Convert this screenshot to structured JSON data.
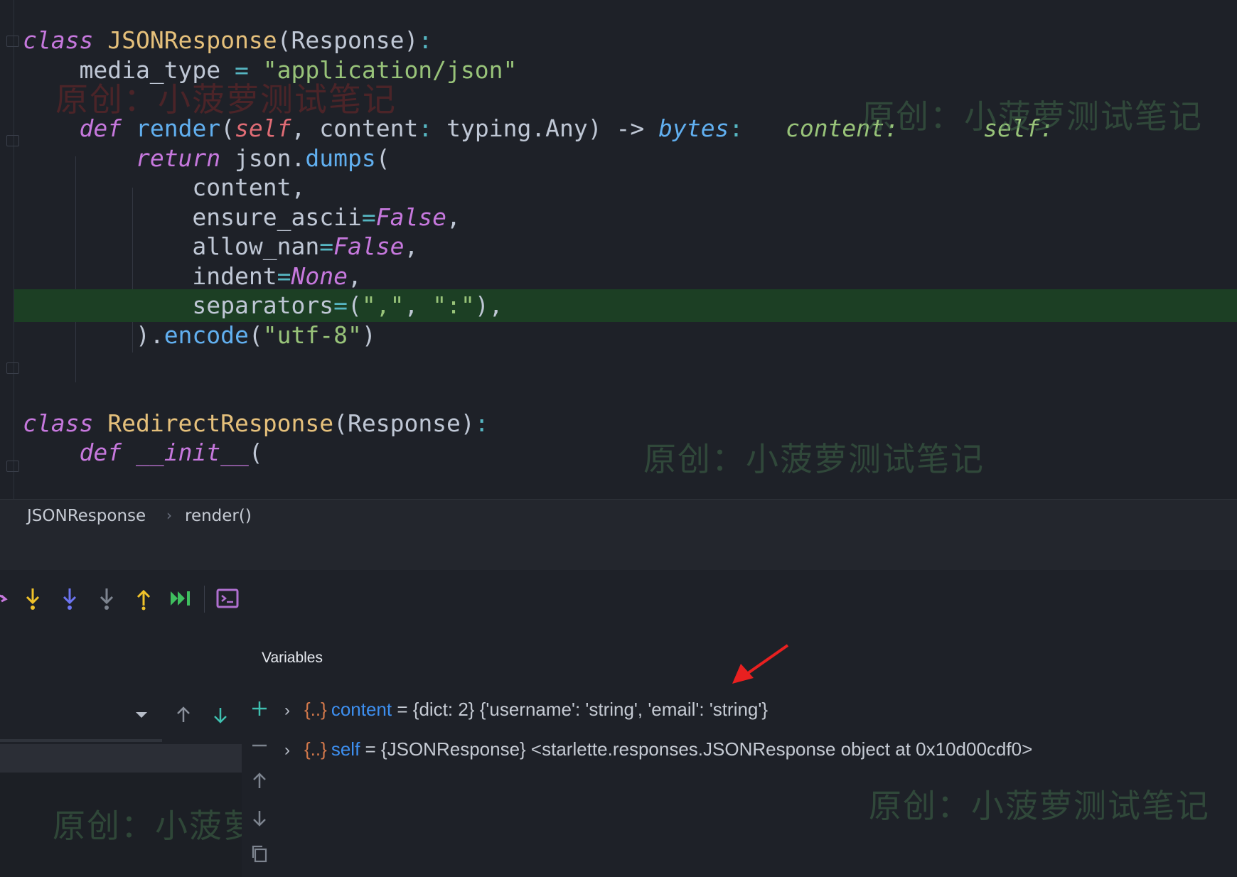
{
  "editor": {
    "lines": [
      {
        "id": "l1",
        "segments": [
          [
            "kw",
            "class"
          ],
          [
            "plain",
            " "
          ],
          [
            "cls",
            "JSONResponse"
          ],
          [
            "plain",
            "(Response)"
          ],
          [
            "op",
            ":"
          ]
        ]
      },
      {
        "id": "l2",
        "segments": [
          [
            "plain",
            "    media_type "
          ],
          [
            "op",
            "="
          ],
          [
            "plain",
            " "
          ],
          [
            "str",
            "\"application/json\""
          ]
        ]
      },
      {
        "id": "l3",
        "segments": []
      },
      {
        "id": "l4",
        "segments": [
          [
            "plain",
            "    "
          ],
          [
            "kw",
            "def"
          ],
          [
            "plain",
            " "
          ],
          [
            "fn",
            "render"
          ],
          [
            "plain",
            "("
          ],
          [
            "self",
            "self"
          ],
          [
            "plain",
            ", content"
          ],
          [
            "op",
            ":"
          ],
          [
            "plain",
            " typing.Any) -> "
          ],
          [
            "type",
            "bytes"
          ],
          [
            "op",
            ":"
          ],
          [
            "plain",
            "   "
          ],
          [
            "hint",
            "content:"
          ],
          [
            "plain",
            "      "
          ],
          [
            "hint",
            "self:"
          ]
        ]
      },
      {
        "id": "l5",
        "segments": [
          [
            "plain",
            "        "
          ],
          [
            "kw",
            "return"
          ],
          [
            "plain",
            " json."
          ],
          [
            "fn",
            "dumps"
          ],
          [
            "plain",
            "("
          ]
        ]
      },
      {
        "id": "l6",
        "segments": [
          [
            "plain",
            "            content,"
          ]
        ]
      },
      {
        "id": "l7",
        "segments": [
          [
            "plain",
            "            ensure_ascii"
          ],
          [
            "op",
            "="
          ],
          [
            "const",
            "False"
          ],
          [
            "plain",
            ","
          ]
        ]
      },
      {
        "id": "l8",
        "segments": [
          [
            "plain",
            "            allow_nan"
          ],
          [
            "op",
            "="
          ],
          [
            "const",
            "False"
          ],
          [
            "plain",
            ","
          ]
        ]
      },
      {
        "id": "l9",
        "segments": [
          [
            "plain",
            "            indent"
          ],
          [
            "op",
            "="
          ],
          [
            "const",
            "None"
          ],
          [
            "plain",
            ","
          ]
        ]
      },
      {
        "id": "l10",
        "segments": [
          [
            "plain",
            "            separators"
          ],
          [
            "op",
            "="
          ],
          [
            "plain",
            "("
          ],
          [
            "str",
            "\",\""
          ],
          [
            "plain",
            ", "
          ],
          [
            "str",
            "\":\""
          ],
          [
            "plain",
            "),"
          ]
        ]
      },
      {
        "id": "l11",
        "segments": [
          [
            "plain",
            "        )."
          ],
          [
            "fn",
            "encode"
          ],
          [
            "plain",
            "("
          ],
          [
            "str",
            "\"utf-8\""
          ],
          [
            "plain",
            ")"
          ]
        ]
      },
      {
        "id": "l12",
        "segments": []
      },
      {
        "id": "l13",
        "segments": []
      },
      {
        "id": "l14",
        "segments": [
          [
            "kw",
            "class"
          ],
          [
            "plain",
            " "
          ],
          [
            "cls",
            "RedirectResponse"
          ],
          [
            "plain",
            "(Response)"
          ],
          [
            "op",
            ":"
          ]
        ]
      },
      {
        "id": "l15",
        "segments": [
          [
            "plain",
            "    "
          ],
          [
            "kw",
            "def"
          ],
          [
            "plain",
            " "
          ],
          [
            "kw",
            "__init__"
          ],
          [
            "plain",
            "("
          ]
        ]
      }
    ],
    "highlight_line": "l10"
  },
  "watermarks": {
    "w1": "原创：小菠萝测试笔记",
    "w2": "原创：小菠萝测试笔记",
    "w3": "原创：小菠萝测试笔记",
    "w4": "原创：小菠萝测试笔记",
    "w5": "原创：小菠萝测试笔记"
  },
  "breadcrumb": {
    "class_name": "JSONResponse",
    "separator": "›",
    "method_name": "render()"
  },
  "debug_toolbar": {
    "icons": [
      "step-over-icon",
      "step-into-icon",
      "step-into-my-code-icon",
      "force-step-into-icon",
      "step-out-icon",
      "run-to-cursor-icon",
      "evaluate-expression-icon"
    ],
    "colors": {
      "step_over": "#c678dd",
      "step_into": "#f0c22a",
      "step_into_my_code": "#6c74f0",
      "force_step_into": "#7d848f",
      "step_out": "#f0c22a",
      "run_to_cursor": "#3fbf5f",
      "evaluate": "#b070d0"
    }
  },
  "variables": {
    "title": "Variables",
    "rows": [
      {
        "icon": "{..}",
        "name": "content",
        "value": " = {dict: 2} {'username': 'string', 'email': 'string'}"
      },
      {
        "icon": "{..}",
        "name": "self",
        "value": " = {JSONResponse} <starlette.responses.JSONResponse object at 0x10d00cdf0>"
      }
    ]
  }
}
